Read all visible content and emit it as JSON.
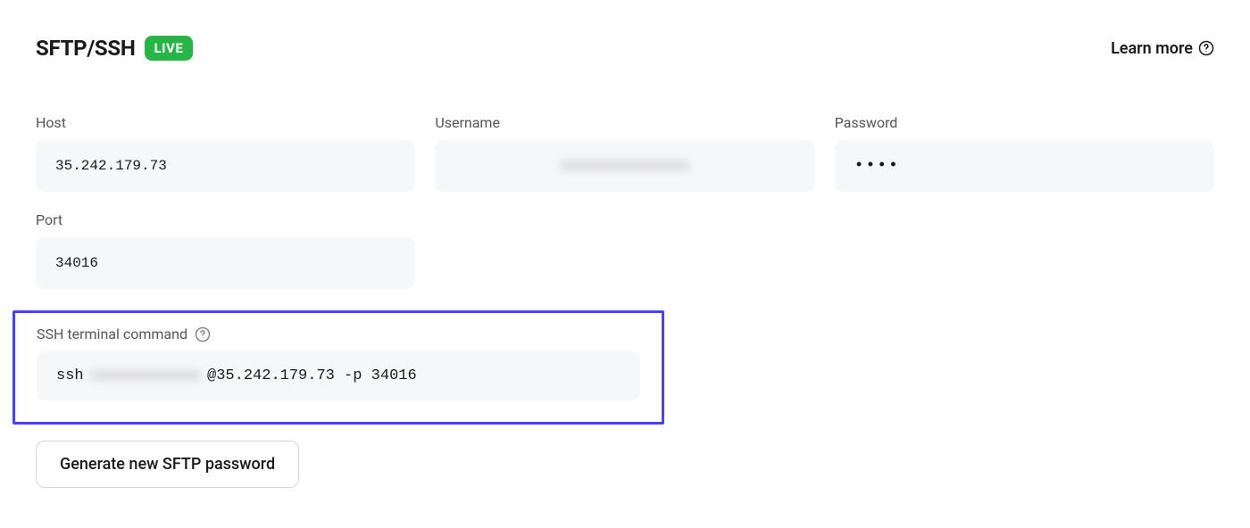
{
  "header": {
    "title": "SFTP/SSH",
    "badge": "LIVE",
    "learn_more": "Learn more"
  },
  "fields": {
    "host": {
      "label": "Host",
      "value": "35.242.179.73"
    },
    "username": {
      "label": "Username",
      "value_masked": "xxxxxxxxxxxxxxx"
    },
    "password": {
      "label": "Password",
      "value_masked": "••••"
    },
    "port": {
      "label": "Port",
      "value": "34016"
    }
  },
  "ssh": {
    "label": "SSH terminal command",
    "prefix": "ssh",
    "username_masked": "xxxxxxxxxxxx",
    "suffix": "@35.242.179.73 -p 34016"
  },
  "buttons": {
    "generate": "Generate new SFTP password"
  }
}
